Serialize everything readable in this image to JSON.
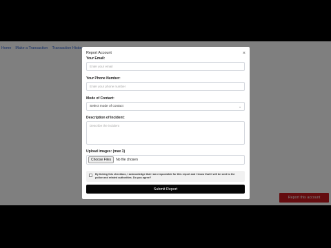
{
  "nav": {
    "items": [
      "Home",
      "Make a Transaction",
      "Transaction History"
    ]
  },
  "page": {
    "report_button_label": "Report this account",
    "report_button_color": "#c8181e"
  },
  "modal": {
    "title": "Report Account",
    "close_glyph": "×",
    "email_label": "Your Email:",
    "email_placeholder": "Enter your email",
    "phone_label": "Your Phone Number:",
    "phone_placeholder": "Enter your phone number",
    "contact_label": "Mode of Contact:",
    "contact_selected": "Select mode of contact",
    "description_label": "Description of Incident:",
    "description_placeholder": "Describe the incident",
    "upload_label": "Upload images: (max 3)",
    "file_button_label": "Choose Files",
    "file_status": "No file chosen",
    "agree_text": "By ticking this checkbox, I acknowledge that I am responsible for this report and I know that it will be sent to the police and related authorities. Do you agree?",
    "agree_checked": false,
    "submit_label": "Submit Report"
  }
}
